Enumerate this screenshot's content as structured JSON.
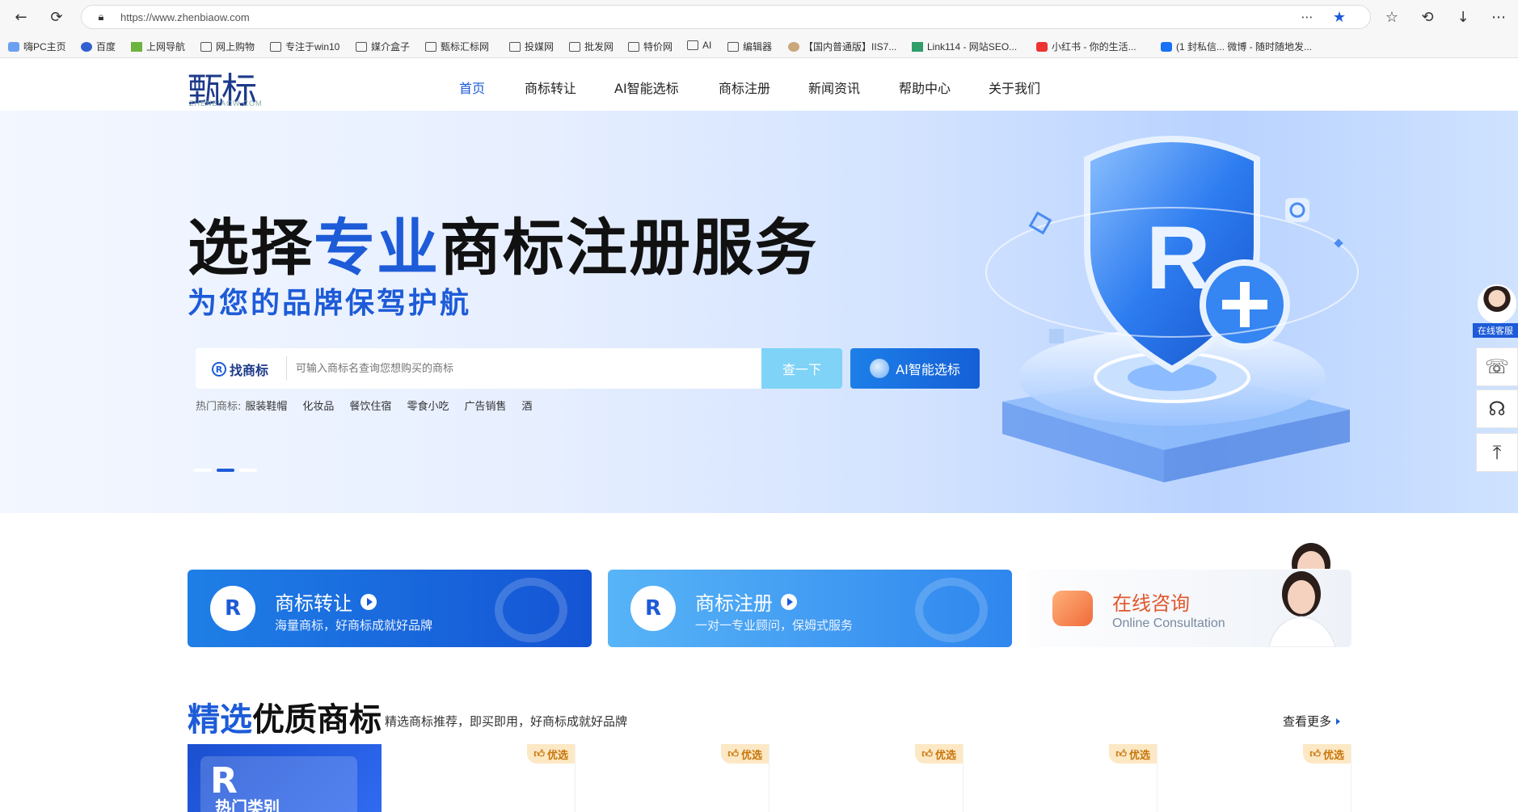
{
  "browser": {
    "url": "https://www.zhenbiaow.com",
    "bookmarks": [
      "嗨PC主页",
      "百度",
      "上网导航",
      "网上购物",
      "专注于win10",
      "媒介盒子",
      "甄标汇标网",
      "投媒网",
      "批发网",
      "特价网",
      "AI",
      "编辑器",
      "【国内普通版】IIS7...",
      "Link114 - 网站SEO...",
      "小红书 - 你的生活...",
      "(1 封私信... 微博 - 随时随地发..."
    ]
  },
  "site": {
    "logo": "甄标",
    "logo_en": "ZHENBIAOW.COM",
    "nav": [
      "首页",
      "商标转让",
      "AI智能选标",
      "商标注册",
      "新闻资讯",
      "帮助中心",
      "关于我们"
    ]
  },
  "hero": {
    "title_pre": "选择",
    "title_hl": "专业",
    "title_post": "商标注册服务",
    "subtitle": "为您的品牌保驾护航",
    "search_label": "找商标",
    "search_placeholder": "可输入商标名查询您想购买的商标",
    "search_button": "查一下",
    "ai_button": "AI智能选标",
    "hot_label": "热门商标:",
    "hot_items": [
      "服装鞋帽",
      "化妆品",
      "餐饮住宿",
      "零食小吃",
      "广告销售",
      "酒"
    ]
  },
  "side": {
    "service_label": "在线客服"
  },
  "cards": {
    "transfer_title": "商标转让",
    "transfer_sub": "海量商标，好商标成就好品牌",
    "register_title": "商标注册",
    "register_sub": "一对一专业顾问，保姆式服务",
    "consult_title": "在线咨询",
    "consult_sub": "Online Consultation"
  },
  "section": {
    "title_hl": "精选",
    "title_rest": "优质商标",
    "desc": "精选商标推荐，即买即用，好商标成就好品牌",
    "more": "查看更多",
    "hot_category": "热门类别",
    "badge": "优选"
  },
  "colors": {
    "brand_blue": "#1d5bd8",
    "accent_orange": "#e1562c"
  }
}
